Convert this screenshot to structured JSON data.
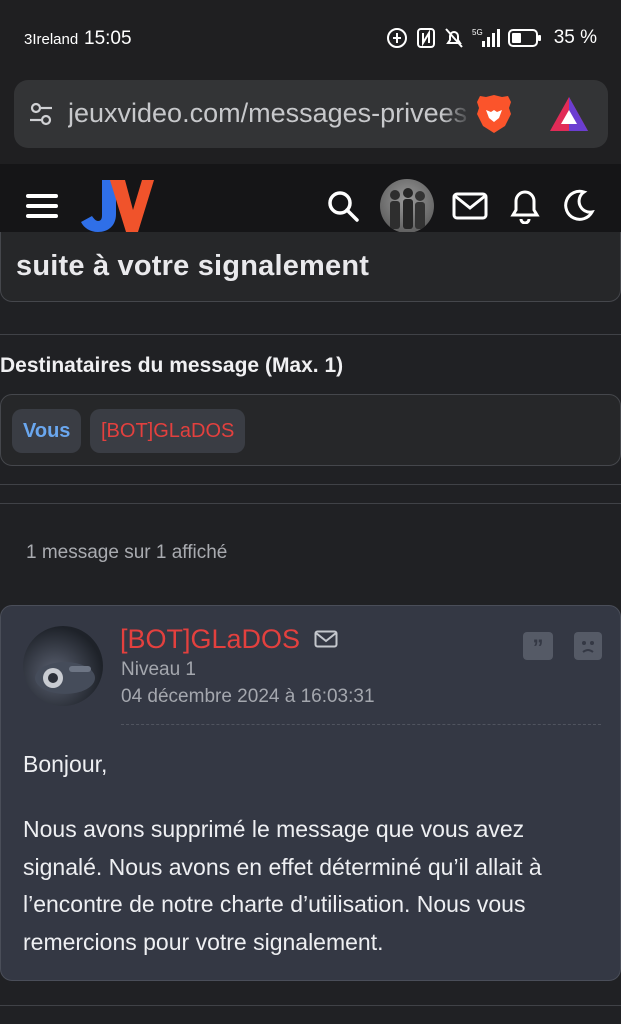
{
  "status_bar": {
    "carrier": "3Ireland",
    "time": "15:05",
    "battery_percent": "35 %",
    "icons": [
      "data-saver-icon",
      "nfc-icon",
      "mute-icon",
      "signal-5g-icon",
      "battery-icon"
    ]
  },
  "browser": {
    "url": "jeuxvideo.com/messages-privees",
    "icons": [
      "tune-icon",
      "brave-lion-icon",
      "brave-rewards-icon"
    ]
  },
  "site_header": {
    "logo": "JV",
    "icons": [
      "menu-icon",
      "search-icon",
      "avatar",
      "mail-icon",
      "bell-icon",
      "dark-mode-icon"
    ]
  },
  "topic": {
    "subject_tail": "suite à votre signalement"
  },
  "recipients": {
    "title": "Destinataires du message (Max. 1)",
    "chips": [
      {
        "label": "Vous",
        "color": "#6aa7ef"
      },
      {
        "label": "[BOT]GLaDOS",
        "color": "#e3403e"
      }
    ]
  },
  "message_count": "1 message sur 1 affiché",
  "message": {
    "author": "[BOT]GLaDOS",
    "level": "Niveau 1",
    "date": "04 décembre 2024 à 16:03:31",
    "quote_glyph": "”",
    "greeting": "Bonjour,",
    "body": "Nous avons supprimé le message que vous avez signalé. Nous avons en effet déterminé qu’il allait à l’encontre de notre charte d’utilisation. Nous vous remercions pour votre signalement."
  },
  "colors": {
    "background": "#202124",
    "card": "#343844",
    "author": "#e3403e",
    "you": "#6aa7ef"
  }
}
